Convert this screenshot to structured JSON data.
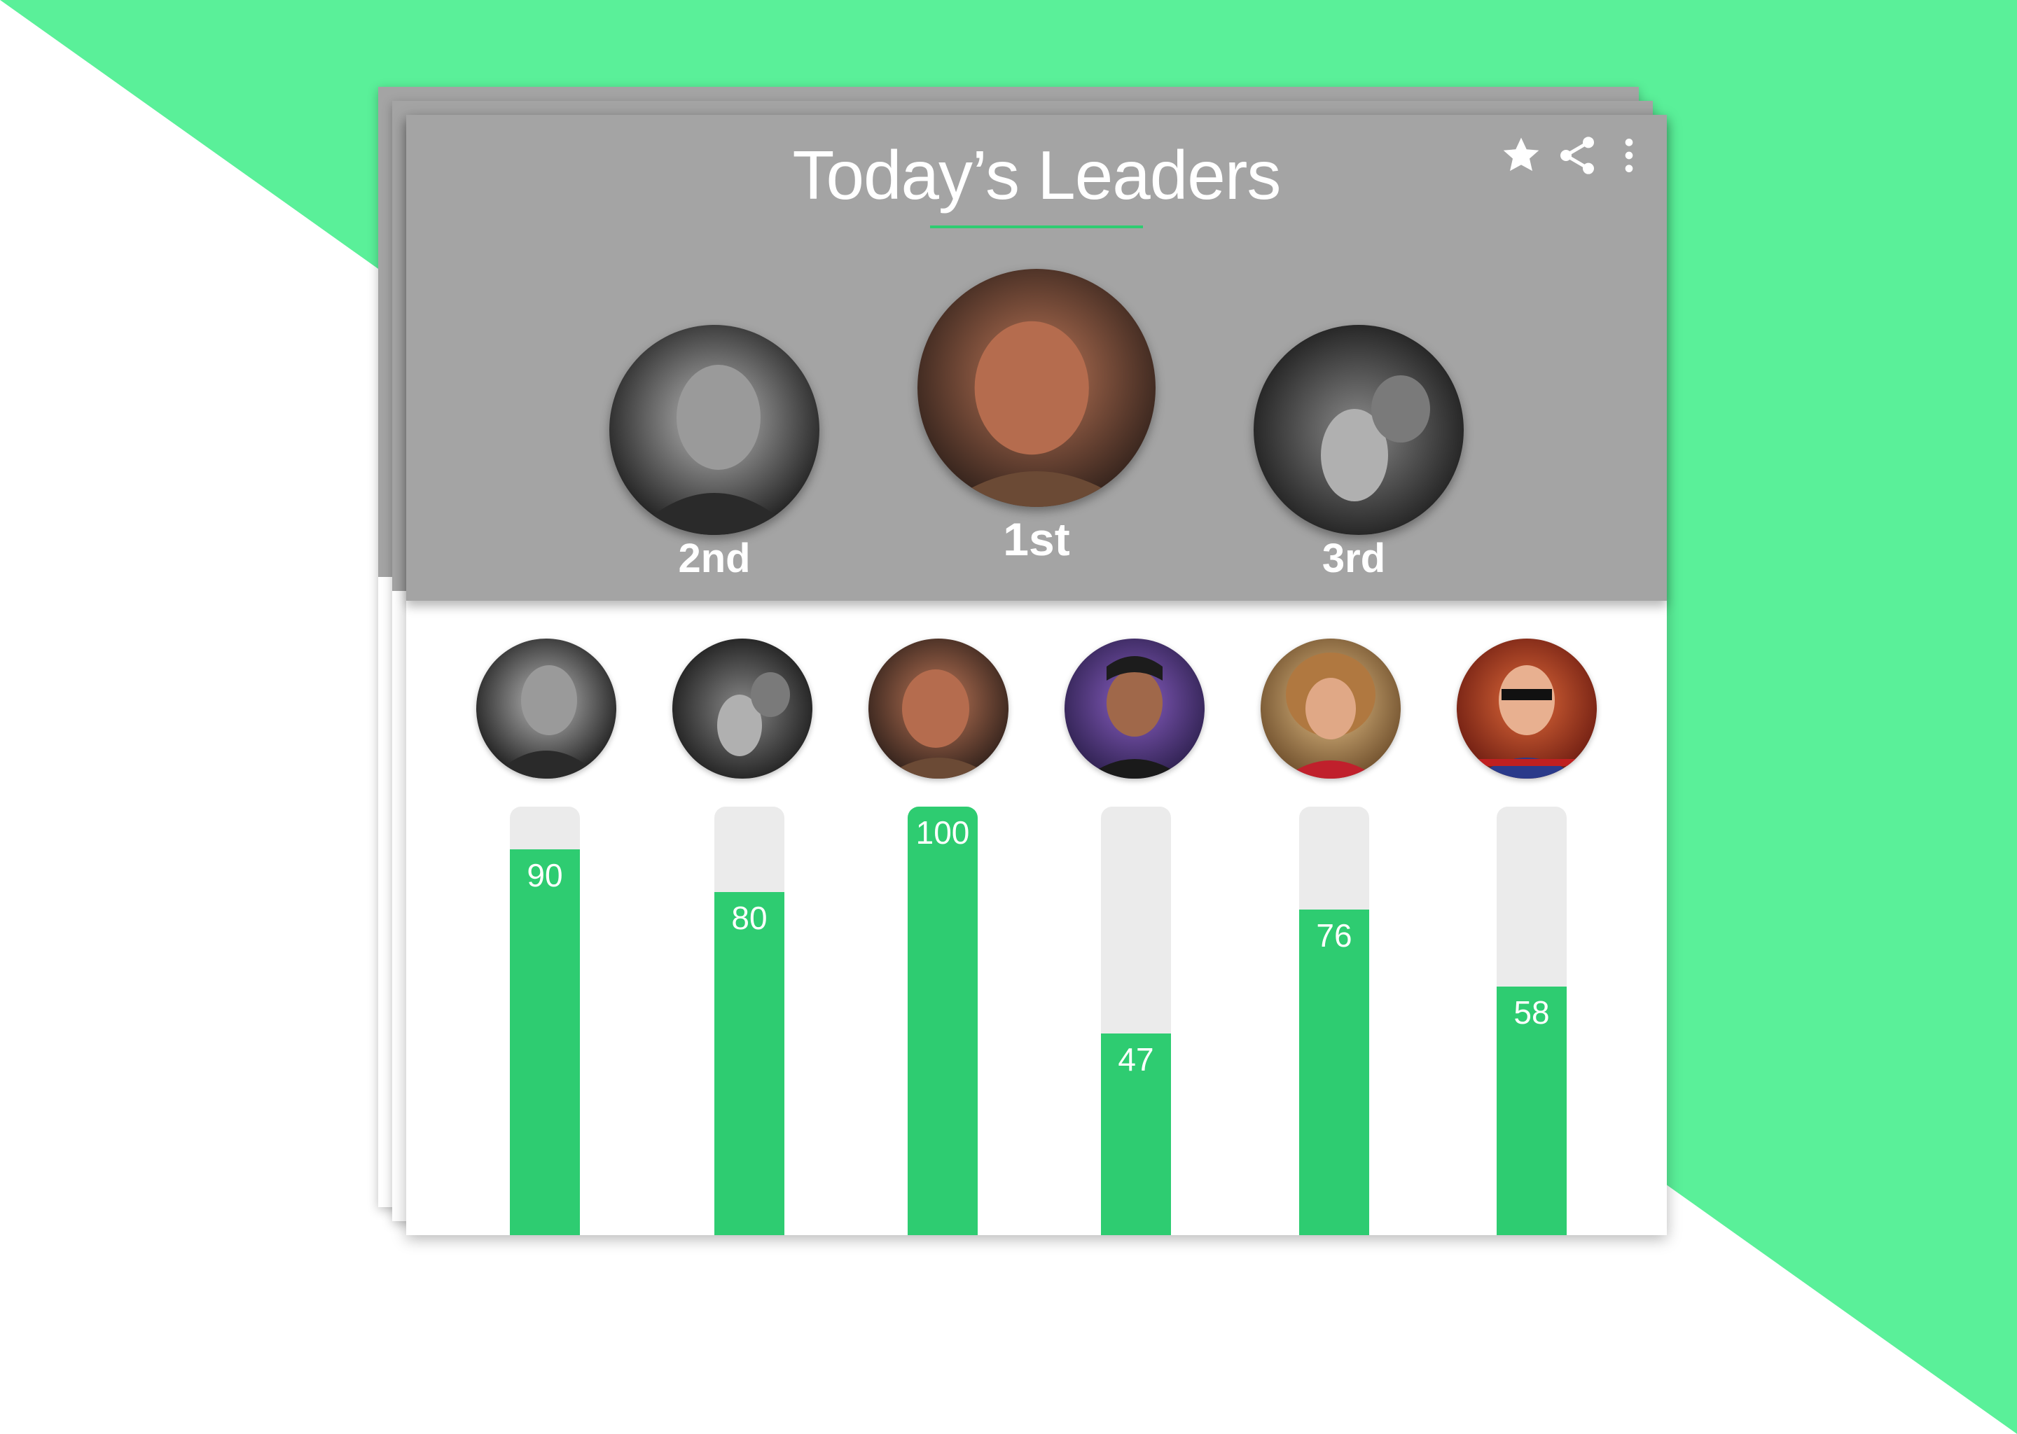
{
  "header": {
    "title": "Today’s Leaders",
    "actions": [
      {
        "icon": "star-icon"
      },
      {
        "icon": "share-icon"
      },
      {
        "icon": "more-vertical-icon"
      }
    ]
  },
  "podium": [
    {
      "rank": 2,
      "label": "2nd"
    },
    {
      "rank": 1,
      "label": "1st"
    },
    {
      "rank": 3,
      "label": "3rd"
    }
  ],
  "chart_data": {
    "type": "bar",
    "categories": [
      "player-1",
      "player-2",
      "player-3",
      "player-4",
      "player-5",
      "player-6"
    ],
    "values": [
      90,
      80,
      100,
      47,
      76,
      58
    ],
    "ylim": [
      0,
      100
    ],
    "title": "",
    "xlabel": "",
    "ylabel": ""
  },
  "colors": {
    "accent": "#2ecc71",
    "background_green": "#5af099",
    "header_gray": "#a4a4a4",
    "bar_track": "#ebebeb"
  }
}
